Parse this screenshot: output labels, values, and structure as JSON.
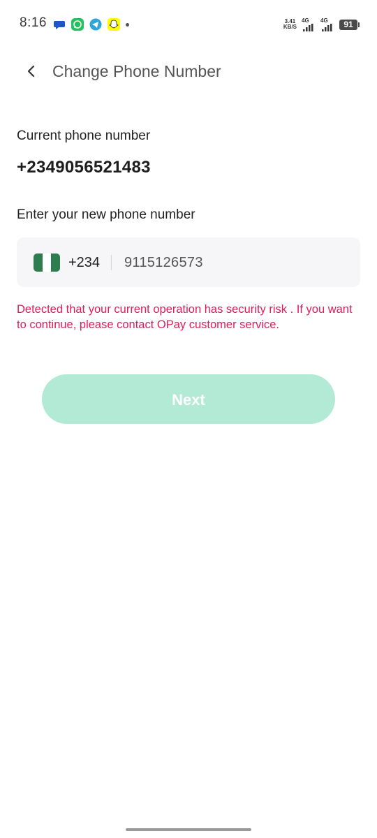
{
  "status_bar": {
    "time": "8:16",
    "speed_value": "3.41",
    "speed_unit": "KB/S",
    "signal1_label": "4G",
    "signal2_label": "4G",
    "battery": "91",
    "notification_icons": [
      "message-icon",
      "whatsapp-icon",
      "telegram-icon",
      "snapchat-icon"
    ]
  },
  "header": {
    "title": "Change Phone Number"
  },
  "current": {
    "label": "Current phone number",
    "number": "+2349056521483"
  },
  "new_number": {
    "label": "Enter your new phone number",
    "country_code": "+234",
    "value": "9115126573"
  },
  "error": {
    "message": "Detected that your current operation has security risk . If you want to continue, please contact OPay customer service."
  },
  "actions": {
    "next_label": "Next"
  },
  "colors": {
    "accent_disabled": "#b3ead6",
    "error": "#e8195a",
    "flag_green": "#2e7d4f"
  }
}
